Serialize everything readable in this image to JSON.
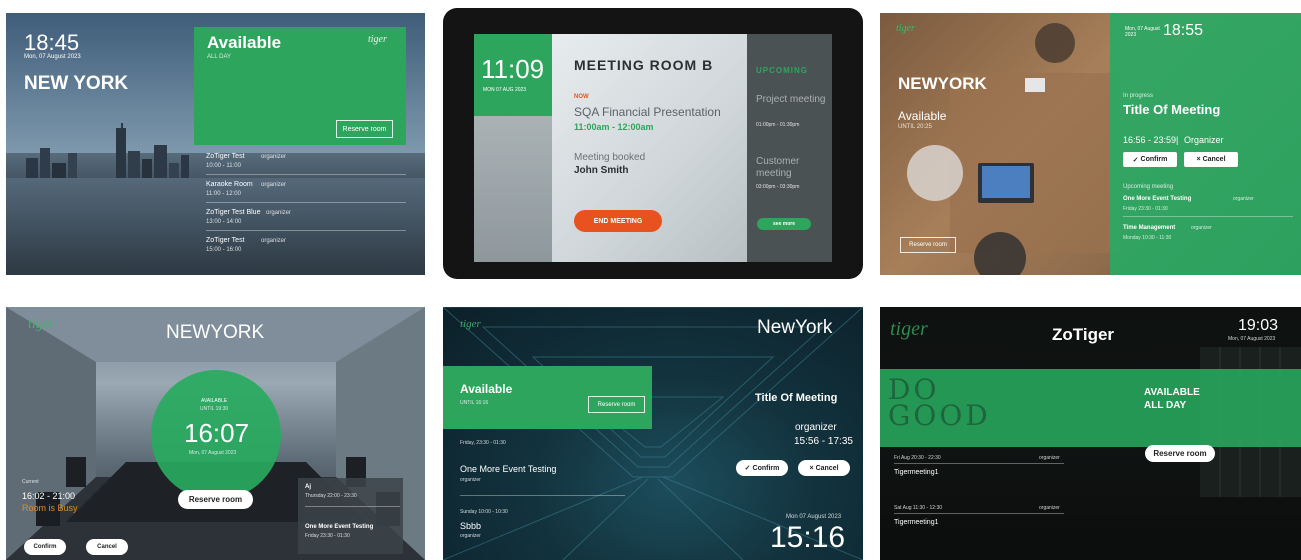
{
  "colors": {
    "accent_green": "#2ea55d",
    "end_meeting": "#e8521f",
    "warning_orange": "#e08a2a"
  },
  "panel1": {
    "time": "18:45",
    "date": "Mon, 07 August 2023",
    "city": "NEW YORK",
    "status": "Available",
    "status_sub": "ALL DAY",
    "logo": "tiger",
    "reserve_button": "Reserve room",
    "meetings": [
      {
        "title": "ZoTiger Test",
        "organizer": "organizer",
        "time": "10:00 - 11:00"
      },
      {
        "title": "Karaoke Room",
        "organizer": "organizer",
        "time": "11:00 - 12:00"
      },
      {
        "title": "ZoTiger Test Blue",
        "organizer": "organizer",
        "time": "13:00 - 14:00"
      },
      {
        "title": "ZoTiger Test",
        "organizer": "organizer",
        "time": "15:00 - 16:00"
      }
    ]
  },
  "panel2": {
    "time": "11:09",
    "date": "MON 07 AUG 2023",
    "room": "MEETING ROOM B",
    "now_label": "NOW",
    "meeting_title": "SQA Financial Presentation",
    "meeting_time": "11:00am - 12:00am",
    "booked_by_label": "Meeting booked",
    "booked_by": "John Smith",
    "end_button": "END MEETING",
    "upcoming_label": "UPCOMING",
    "upcoming": [
      {
        "title": "Project meeting",
        "time": "01:00pm - 01:30pm"
      },
      {
        "title": "Customer meeting",
        "time": "03:00pm - 03:30pm"
      }
    ],
    "see_more": "see more"
  },
  "panel3": {
    "logo": "tiger",
    "date": "Mon, 07 August 2023",
    "time": "18:55",
    "city": "NEWYORK",
    "status": "Available",
    "status_sub": "UNTIL 20:25",
    "reserve_button": "Reserve room",
    "in_progress_label": "In progress",
    "meeting_title": "Title Of Meeting",
    "meeting_time": "16:56 - 23:59",
    "organizer": "Organizer",
    "confirm_button": "Confirm",
    "cancel_button": "Cancel",
    "upcoming_label": "Upcoming meeting",
    "upcoming": [
      {
        "title": "One More Event Testing",
        "organizer": "organizer",
        "time": "Friday 23:30 - 01:30"
      },
      {
        "title": "Time Management",
        "organizer": "organizer",
        "time": "Monday 10:30 - 11:30"
      }
    ]
  },
  "panel4": {
    "logo": "tiger",
    "city": "NEWYORK",
    "status": "AVAILABLE",
    "status_sub": "UNTIL 19:30",
    "time": "16:07",
    "date": "Mon, 07 August 2023",
    "reserve_button": "Reserve room",
    "current_label": "Current",
    "current_time": "16:02 - 21:00",
    "current_title": "Room is Busy",
    "confirm_button": "Confirm",
    "cancel_button": "Cancel",
    "upcoming": [
      {
        "title": "Aj",
        "time": "Thursday 22:00 - 23:30"
      },
      {
        "title": "One More Event Testing",
        "time": "Friday 23:30 - 01:30"
      }
    ]
  },
  "panel5": {
    "logo": "tiger",
    "city": "NewYork",
    "status": "Available",
    "status_sub": "UNTIL 16:16",
    "reserve_button": "Reserve room",
    "meeting_title": "Title Of Meeting",
    "organizer": "organizer",
    "meeting_time": "15:56 - 17:35",
    "confirm_button": "Confirm",
    "cancel_button": "Cancel",
    "list": [
      {
        "label": "Friday, 23:30 - 01:30",
        "title": "One More Event Testing",
        "organizer": "organizer"
      },
      {
        "label": "Sunday 10:00 - 10:30",
        "title": "Sbbb",
        "organizer": "organizer"
      }
    ],
    "date": "Mon 07 August 2023",
    "time": "15:16"
  },
  "panel6": {
    "logo": "tiger",
    "title": "ZoTiger",
    "time": "19:03",
    "date": "Mon, 07 August 2023",
    "wall_text": "DO GOOD",
    "status_line1": "AVAILABLE",
    "status_line2": "ALL DAY",
    "reserve_button": "Reserve room",
    "meetings": [
      {
        "time": "Fri Aug 20:30 - 22:30",
        "organizer": "organizer",
        "title": "Tigermeeting1"
      },
      {
        "time": "Sat Aug 11:30 - 12:30",
        "organizer": "organizer",
        "title": "Tigermeeting1"
      }
    ]
  }
}
